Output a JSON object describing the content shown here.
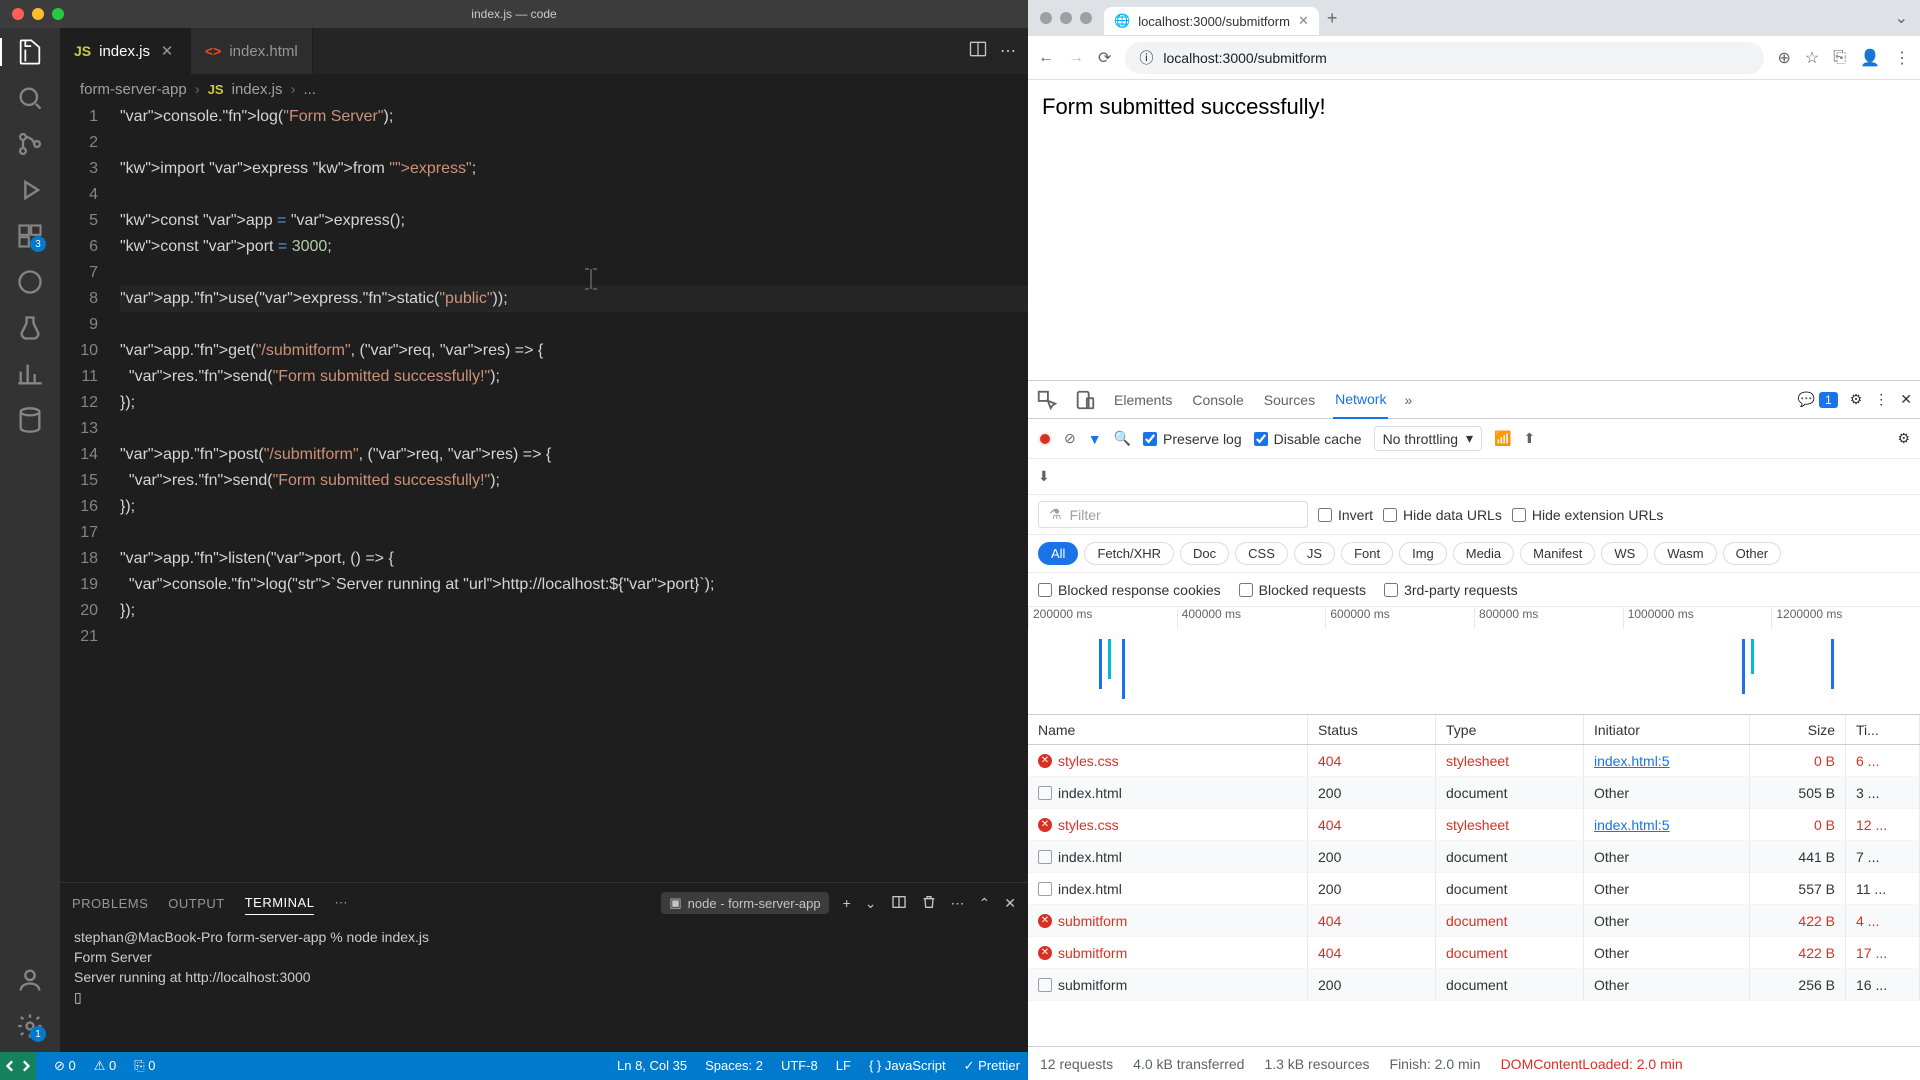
{
  "vscode": {
    "title": "index.js — code",
    "tabs": [
      {
        "icon": "JS",
        "label": "index.js",
        "active": true,
        "dirty": false
      },
      {
        "icon": "<>",
        "label": "index.html",
        "active": false
      }
    ],
    "breadcrumb": {
      "folder": "form-server-app",
      "file": "index.js",
      "trail": "..."
    },
    "activity_badges": {
      "ext": "3",
      "settings": "1"
    },
    "lines": 21,
    "code": [
      "console.log(\"Form Server\");",
      "",
      "import express from \"express\";",
      "",
      "const app = express();",
      "const port = 3000;",
      "",
      "app.use(express.static(\"public\"));",
      "",
      "app.get(\"/submitform\", (req, res) => {",
      "  res.send(\"Form submitted successfully!\");",
      "});",
      "",
      "app.post(\"/submitform\", (req, res) => {",
      "  res.send(\"Form submitted successfully!\");",
      "});",
      "",
      "app.listen(port, () => {",
      "  console.log(`Server running at http://localhost:${port}`);",
      "});",
      ""
    ],
    "panel": {
      "tabs": [
        "PROBLEMS",
        "OUTPUT",
        "TERMINAL"
      ],
      "active": "TERMINAL",
      "term_selector": "node - form-server-app",
      "terminal": [
        "stephan@MacBook-Pro form-server-app % node index.js",
        "Form Server",
        "Server running at http://localhost:3000",
        "▯"
      ]
    },
    "status": {
      "errors": "0",
      "warnings": "0",
      "ports": "0",
      "cursor": "Ln 8, Col 35",
      "spaces": "Spaces: 2",
      "encoding": "UTF-8",
      "eol": "LF",
      "lang": "JavaScript",
      "prettier": "Prettier"
    }
  },
  "browser": {
    "tab_title": "localhost:3000/submitform",
    "url": "localhost:3000/submitform",
    "page_text": "Form submitted successfully!",
    "devtools": {
      "tabs": [
        "Elements",
        "Console",
        "Sources",
        "Network"
      ],
      "active": "Network",
      "msg_count": "1",
      "preserve_log": true,
      "disable_cache": true,
      "throttling": "No throttling",
      "filter_placeholder": "Filter",
      "invert": "Invert",
      "hide_data": "Hide data URLs",
      "hide_ext": "Hide extension URLs",
      "types": [
        "All",
        "Fetch/XHR",
        "Doc",
        "CSS",
        "JS",
        "Font",
        "Img",
        "Media",
        "Manifest",
        "WS",
        "Wasm",
        "Other"
      ],
      "blocked1": "Blocked response cookies",
      "blocked2": "Blocked requests",
      "blocked3": "3rd-party requests",
      "timeline": [
        "200000 ms",
        "400000 ms",
        "600000 ms",
        "800000 ms",
        "1000000 ms",
        "1200000 ms"
      ],
      "columns": [
        "Name",
        "Status",
        "Type",
        "Initiator",
        "Size",
        "Ti..."
      ],
      "rows": [
        {
          "name": "styles.css",
          "status": "404",
          "type": "stylesheet",
          "initiator": "index.html:5",
          "size": "0 B",
          "time": "6 ...",
          "err": true,
          "link": true
        },
        {
          "name": "index.html",
          "status": "200",
          "type": "document",
          "initiator": "Other",
          "size": "505 B",
          "time": "3 ...",
          "err": false
        },
        {
          "name": "styles.css",
          "status": "404",
          "type": "stylesheet",
          "initiator": "index.html:5",
          "size": "0 B",
          "time": "12 ...",
          "err": true,
          "link": true
        },
        {
          "name": "index.html",
          "status": "200",
          "type": "document",
          "initiator": "Other",
          "size": "441 B",
          "time": "7 ...",
          "err": false
        },
        {
          "name": "index.html",
          "status": "200",
          "type": "document",
          "initiator": "Other",
          "size": "557 B",
          "time": "11 ...",
          "err": false
        },
        {
          "name": "submitform",
          "status": "404",
          "type": "document",
          "initiator": "Other",
          "size": "422 B",
          "time": "4 ...",
          "err": true
        },
        {
          "name": "submitform",
          "status": "404",
          "type": "document",
          "initiator": "Other",
          "size": "422 B",
          "time": "17 ...",
          "err": true
        },
        {
          "name": "submitform",
          "status": "200",
          "type": "document",
          "initiator": "Other",
          "size": "256 B",
          "time": "16 ...",
          "err": false
        }
      ],
      "summary": {
        "requests": "12 requests",
        "transferred": "4.0 kB transferred",
        "resources": "1.3 kB resources",
        "finish": "Finish: 2.0 min",
        "dom": "DOMContentLoaded: 2.0 min"
      }
    }
  }
}
